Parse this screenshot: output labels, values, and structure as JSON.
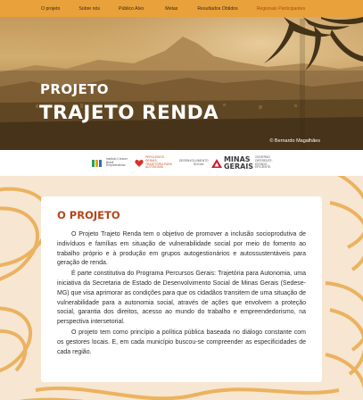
{
  "nav": {
    "items": [
      {
        "label": "O projeto"
      },
      {
        "label": "Sobre nós"
      },
      {
        "label": "Público Alvo"
      },
      {
        "label": "Metas"
      },
      {
        "label": "Resultados Obtidos"
      },
      {
        "label": "Regionais Participantes"
      }
    ],
    "active_index": 5
  },
  "hero": {
    "subtitle": "PROJETO",
    "title": "TRAJETO RENDA",
    "photo_credit": "© Bernardo Magalhães"
  },
  "logos": {
    "icbe_name": "ICBE",
    "icbe_text": "Instituto Crescer Brasil Empreendedor",
    "percursos_text": "PERCURSOS GERAIS: TRAJETÓRIA PARA AUTONOMIA",
    "sedese_text": "DESENVOLVIMENTO SOCIAL",
    "mg_name_line1": "MINAS",
    "mg_name_line2": "GERAIS",
    "mg_tagline": "GOVERNO DIFERENTE. ESTADO EFICIENTE."
  },
  "section": {
    "heading": "O PROJETO",
    "paragraphs": [
      "O Projeto Trajeto Renda tem o objetivo de promover a inclusão socioprodutiva de indivíduos e famílias em situação de vulnerabilidade social por meio do fomento ao trabalho próprio e à produção em grupos autogestionários e autossustentáveis para geração de renda.",
      "É parte constitutiva do Programa Percursos Gerais: Trajetória para Autonomia, uma iniciativa da Secretaria de Estado de Desenvolvimento Social de Minas Gerais (Sedese-MG) que visa aprimorar as condições para que os cidadãos transitem de uma situação de vulnerabilidade para a autonomia social, através de ações que envolvem a proteção social, garantia dos direitos, acesso ao mundo do trabalho e empreendedorismo, na perspectiva intersetorial.",
      "O projeto tem como princípio a política pública baseada no diálogo constante com os gestores locais. E, em cada município buscou-se compreender as especificidades de cada região."
    ]
  },
  "colors": {
    "accent_orange": "#e8a13b",
    "heading_red": "#b5441a",
    "section_bg": "#f6e6d2"
  }
}
